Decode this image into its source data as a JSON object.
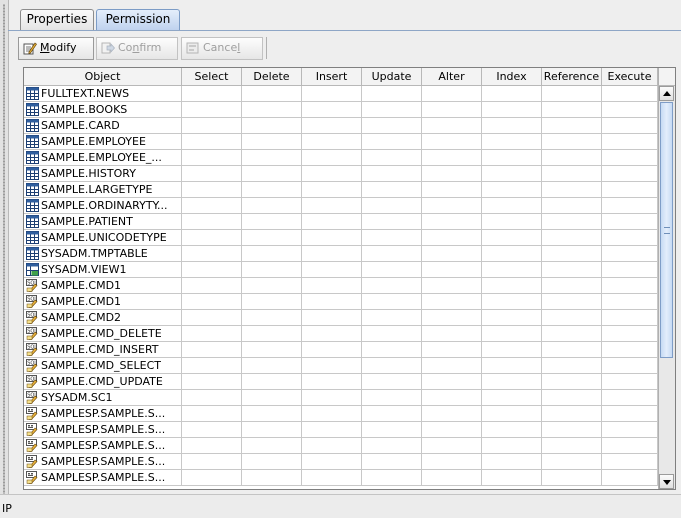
{
  "tabs": [
    {
      "label": "Properties",
      "active": false
    },
    {
      "label": "Permission",
      "active": true
    }
  ],
  "toolbar": {
    "modify": {
      "label": "Modify",
      "mnemonic": "M",
      "enabled": true,
      "icon": "edit-pencil-icon"
    },
    "confirm": {
      "label": "Confirm",
      "mnemonic": "f",
      "enabled": false,
      "icon": "confirm-arrow-icon"
    },
    "cancel": {
      "label": "Cancel",
      "mnemonic": "l",
      "enabled": false,
      "icon": "cancel-icon"
    }
  },
  "grid": {
    "columns": [
      "Object",
      "Select",
      "Delete",
      "Insert",
      "Update",
      "Alter",
      "Index",
      "Reference",
      "Execute"
    ],
    "rows": [
      {
        "object": "FULLTEXT.NEWS",
        "icon": "table-icon",
        "perms": [
          "",
          "",
          "",
          "",
          "",
          "",
          "",
          ""
        ]
      },
      {
        "object": "SAMPLE.BOOKS",
        "icon": "table-icon",
        "perms": [
          "",
          "",
          "",
          "",
          "",
          "",
          "",
          ""
        ]
      },
      {
        "object": "SAMPLE.CARD",
        "icon": "table-icon",
        "perms": [
          "",
          "",
          "",
          "",
          "",
          "",
          "",
          ""
        ]
      },
      {
        "object": "SAMPLE.EMPLOYEE",
        "icon": "table-icon",
        "perms": [
          "",
          "",
          "",
          "",
          "",
          "",
          "",
          ""
        ]
      },
      {
        "object": "SAMPLE.EMPLOYEE_...",
        "icon": "table-icon",
        "perms": [
          "",
          "",
          "",
          "",
          "",
          "",
          "",
          ""
        ]
      },
      {
        "object": "SAMPLE.HISTORY",
        "icon": "table-icon",
        "perms": [
          "",
          "",
          "",
          "",
          "",
          "",
          "",
          ""
        ]
      },
      {
        "object": "SAMPLE.LARGETYPE",
        "icon": "table-icon",
        "perms": [
          "",
          "",
          "",
          "",
          "",
          "",
          "",
          ""
        ]
      },
      {
        "object": "SAMPLE.ORDINARYTY...",
        "icon": "table-icon",
        "perms": [
          "",
          "",
          "",
          "",
          "",
          "",
          "",
          ""
        ]
      },
      {
        "object": "SAMPLE.PATIENT",
        "icon": "table-icon",
        "perms": [
          "",
          "",
          "",
          "",
          "",
          "",
          "",
          ""
        ]
      },
      {
        "object": "SAMPLE.UNICODETYPE",
        "icon": "table-icon",
        "perms": [
          "",
          "",
          "",
          "",
          "",
          "",
          "",
          ""
        ]
      },
      {
        "object": "SYSADM.TMPTABLE",
        "icon": "table-icon",
        "perms": [
          "",
          "",
          "",
          "",
          "",
          "",
          "",
          ""
        ]
      },
      {
        "object": "SYSADM.VIEW1",
        "icon": "view-icon",
        "perms": [
          "",
          "",
          "",
          "",
          "",
          "",
          "",
          ""
        ]
      },
      {
        "object": "SAMPLE.CMD1",
        "icon": "command-icon",
        "perms": [
          "",
          "",
          "",
          "",
          "",
          "",
          "",
          ""
        ]
      },
      {
        "object": "SAMPLE.CMD1",
        "icon": "command-icon",
        "perms": [
          "",
          "",
          "",
          "",
          "",
          "",
          "",
          ""
        ]
      },
      {
        "object": "SAMPLE.CMD2",
        "icon": "command-icon",
        "perms": [
          "",
          "",
          "",
          "",
          "",
          "",
          "",
          ""
        ]
      },
      {
        "object": "SAMPLE.CMD_DELETE",
        "icon": "command-icon",
        "perms": [
          "",
          "",
          "",
          "",
          "",
          "",
          "",
          ""
        ]
      },
      {
        "object": "SAMPLE.CMD_INSERT",
        "icon": "command-icon",
        "perms": [
          "",
          "",
          "",
          "",
          "",
          "",
          "",
          ""
        ]
      },
      {
        "object": "SAMPLE.CMD_SELECT",
        "icon": "command-icon",
        "perms": [
          "",
          "",
          "",
          "",
          "",
          "",
          "",
          ""
        ]
      },
      {
        "object": "SAMPLE.CMD_UPDATE",
        "icon": "command-icon",
        "perms": [
          "",
          "",
          "",
          "",
          "",
          "",
          "",
          ""
        ]
      },
      {
        "object": "SYSADM.SC1",
        "icon": "command-icon",
        "perms": [
          "",
          "",
          "",
          "",
          "",
          "",
          "",
          ""
        ]
      },
      {
        "object": "SAMPLESP.SAMPLE.S...",
        "icon": "procedure-icon",
        "perms": [
          "",
          "",
          "",
          "",
          "",
          "",
          "",
          ""
        ]
      },
      {
        "object": "SAMPLESP.SAMPLE.S...",
        "icon": "procedure-icon",
        "perms": [
          "",
          "",
          "",
          "",
          "",
          "",
          "",
          ""
        ]
      },
      {
        "object": "SAMPLESP.SAMPLE.S...",
        "icon": "procedure-icon",
        "perms": [
          "",
          "",
          "",
          "",
          "",
          "",
          "",
          ""
        ]
      },
      {
        "object": "SAMPLESP.SAMPLE.S...",
        "icon": "procedure-icon",
        "perms": [
          "",
          "",
          "",
          "",
          "",
          "",
          "",
          ""
        ]
      },
      {
        "object": "SAMPLESP.SAMPLE.S...",
        "icon": "procedure-icon",
        "perms": [
          "",
          "",
          "",
          "",
          "",
          "",
          "",
          ""
        ]
      }
    ]
  },
  "status": {
    "text": "IP"
  },
  "colors": {
    "tab_active": "#bfd2ee",
    "scroll_thumb": "#c6daf4",
    "grid_line": "#c8c8c8"
  }
}
